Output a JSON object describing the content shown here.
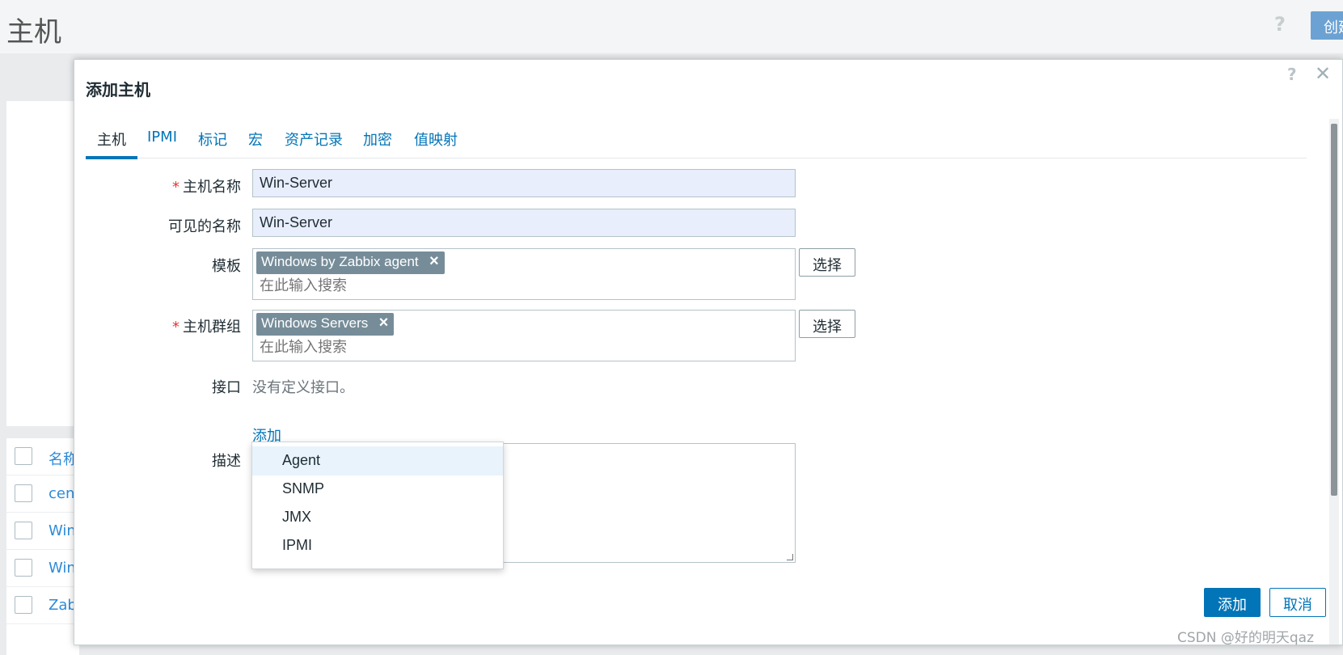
{
  "page": {
    "title": "主机",
    "help": "?",
    "create_label": "创建主机",
    "list_header": "名称",
    "list_rows": [
      "cent",
      "Win",
      "Win",
      "Zab"
    ]
  },
  "modal": {
    "title": "添加主机",
    "help": "?",
    "close": "✕",
    "tabs": [
      "主机",
      "IPMI",
      "标记",
      "宏",
      "资产记录",
      "加密",
      "值映射"
    ],
    "active_tab": "主机",
    "form": {
      "host_name_label": "主机名称",
      "host_name_value": "Win-Server",
      "visible_name_label": "可见的名称",
      "visible_name_value": "Win-Server",
      "templates_label": "模板",
      "templates_chip": "Windows by Zabbix agent",
      "templates_placeholder": "在此输入搜索",
      "groups_label": "主机群组",
      "groups_chip": "Windows Servers",
      "groups_placeholder": "在此输入搜索",
      "select_label": "选择",
      "interfaces_label": "接口",
      "interfaces_text": "没有定义接口。",
      "add_link": "添加",
      "description_label": "描述",
      "required_mark": "*"
    },
    "dropdown": {
      "items": [
        "Agent",
        "SNMP",
        "JMX",
        "IPMI"
      ],
      "highlighted": "Agent"
    },
    "buttons": {
      "add": "添加",
      "cancel": "取消"
    }
  },
  "watermark": "CSDN @好的明天qaz",
  "colors": {
    "accent": "#0275b8",
    "chip": "#768d99",
    "required": "#e33734",
    "input_autofill": "#e8eefb"
  }
}
